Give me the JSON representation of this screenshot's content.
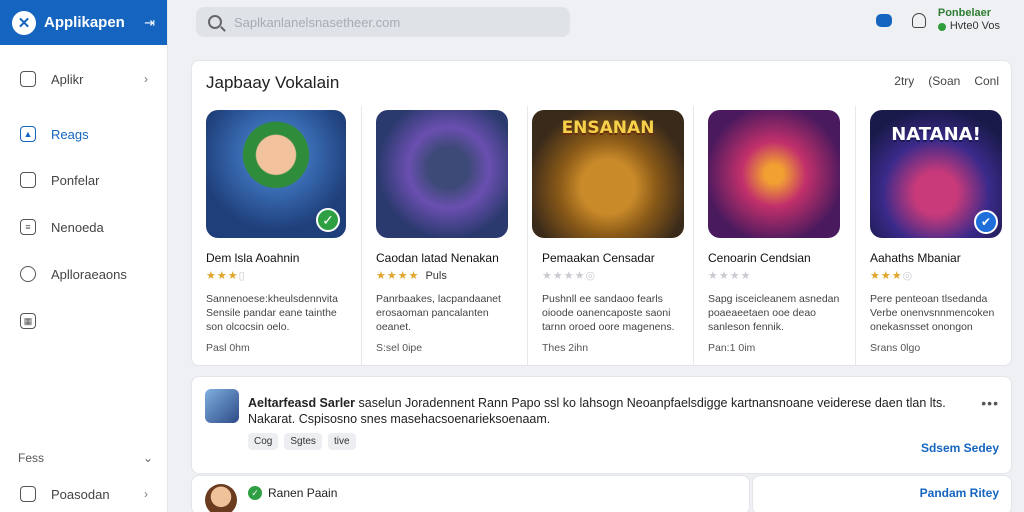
{
  "sidebar": {
    "brand": "Applikapen",
    "items": [
      {
        "label": "Aplikr",
        "icon": "apps-icon"
      },
      {
        "label": "Reags",
        "icon": "rank-icon"
      },
      {
        "label": "Ponfelar",
        "icon": "book-icon"
      },
      {
        "label": "Nenoeda",
        "icon": "news-icon"
      },
      {
        "label": "Aplloraeaons",
        "icon": "globe-icon"
      },
      {
        "label": "",
        "icon": "grid-icon"
      }
    ],
    "section_label": "Fess",
    "bottom_item": {
      "label": "Poasodan",
      "icon": "folder-icon"
    }
  },
  "topbar": {
    "search_placeholder": "Saplkanlanelsnasetheer.com",
    "user_name": "Ponbelaer",
    "user_status": "Hvte0 Vos"
  },
  "featured": {
    "title": "Japbaay Vokalain",
    "controls": [
      "2try",
      "(Soan",
      "Conl"
    ],
    "apps": [
      {
        "name": "Dem lsla Aoahnin",
        "stars": 3,
        "rating_label": "",
        "desc": "Sannenoese:kheulsdennvita Sensile pandar eane tainthe son olcocsin oelo.",
        "meta": "Pasl 0hm",
        "badge": "check"
      },
      {
        "name": "Caodan latad Nenakan",
        "stars": 4,
        "rating_label": "Puls",
        "desc": "Panrbaakes, lacpandaanet erosaoman pancalanten oeanet.",
        "meta": "S:sel 0ipe",
        "badge": ""
      },
      {
        "name": "Pemaakan Censadar",
        "stars": 0,
        "rating_label": "",
        "desc": "Pushnll ee sandaoo fearls oioode oanencaposte saoni tarnn oroed oore magenens.",
        "meta": "Thes 2ihn",
        "badge": "",
        "art_title": "ENSANAN"
      },
      {
        "name": "Cenoarin Cendsian",
        "stars": 0,
        "rating_label": "",
        "desc": "Sapg isceicleanem asnedan poaeaeetaen ooe deao sanleson fennik.",
        "meta": "Pan:1 0im",
        "badge": ""
      },
      {
        "name": "Aahaths Mbaniar",
        "stars": 3,
        "rating_label": "",
        "desc": "Pere penteoan tlsedanda Verbe onenvsnnmencoken onekasnsset onongon",
        "meta": "Srans 0lgo",
        "badge": "blue",
        "art_title": "NATANA!"
      }
    ]
  },
  "post": {
    "author": "Aeltarfeasd Sarler",
    "text": "saselun Joradennent Rann Papo ssl ko lahsogn Neoanpfaelsdigge kartnansnoane veiderese daen tlan lts. Nakarat. Cspisosno snes masehacsoenarieksoenaam.",
    "tags": [
      "Cog",
      "Sgtes",
      "tive"
    ],
    "more": "•••",
    "link": "Sdsem Sedey"
  },
  "bottom": {
    "user": "Ranen Paain",
    "link": "Pandam Ritey"
  }
}
